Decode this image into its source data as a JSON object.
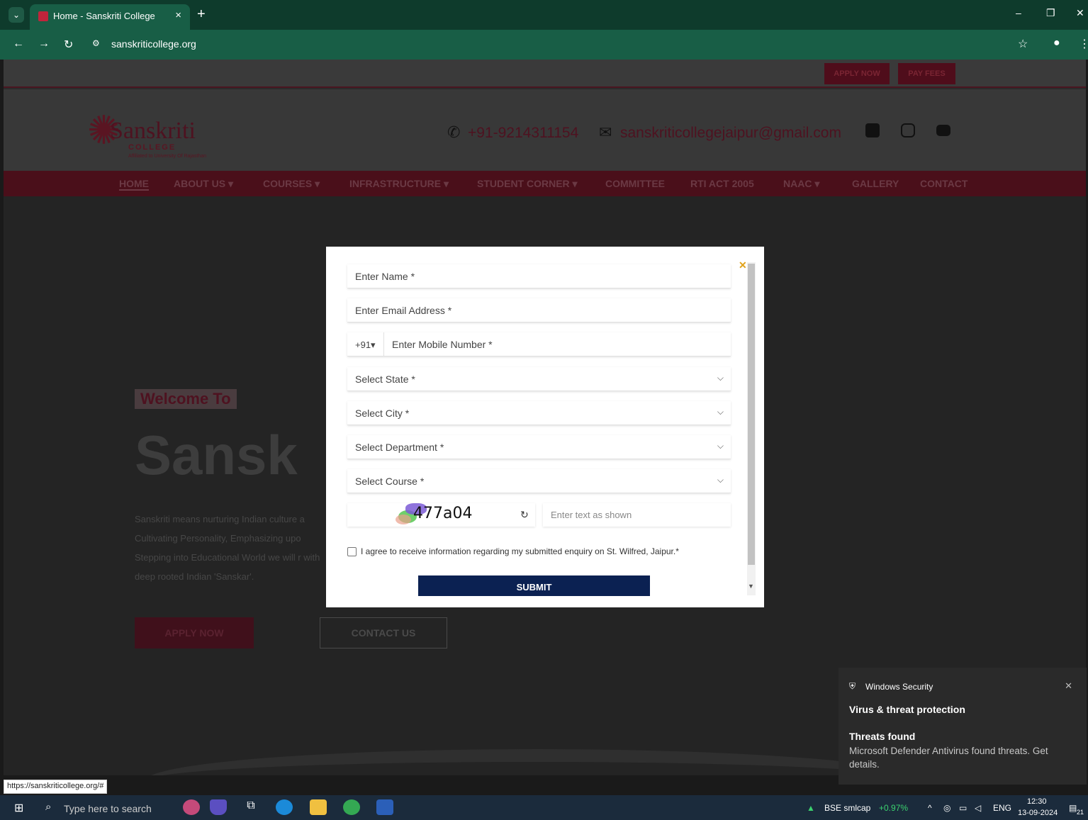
{
  "browser": {
    "tab_title": "Home - Sanskriti College",
    "url": "sanskriticollege.org",
    "status_url": "https://sanskriticollege.org/#"
  },
  "page": {
    "top_buttons": [
      "APPLY NOW",
      "PAY FEES"
    ],
    "logo_name": "Sanskriti",
    "logo_sub": "COLLEGE",
    "logo_tag": "Affiliated to University Of Rajasthan",
    "phone": "+91-9214311154",
    "email": "sanskriticollegejaipur@gmail.com",
    "nav": [
      "HOME",
      "ABOUT US ▾",
      "COURSES ▾",
      "INFRASTRUCTURE ▾",
      "STUDENT CORNER ▾",
      "COMMITTEE",
      "RTI ACT 2005",
      "NAAC ▾",
      "GALLERY",
      "CONTACT"
    ],
    "hero_welcome": "Welcome To",
    "hero_title": "Sansk",
    "hero_text": "Sanskriti means nurturing Indian culture a Cultivating Personality, Emphasizing upo Stepping into Educational World we will r with deep rooted Indian 'Sanskar'.",
    "hero_apply": "APPLY NOW",
    "hero_contact": "CONTACT US"
  },
  "modal": {
    "name_placeholder": "Enter Name *",
    "email_placeholder": "Enter Email Address *",
    "country_code": "+91▾",
    "mobile_placeholder": "Enter Mobile Number *",
    "state_select": "Select State *",
    "city_select": "Select City *",
    "department_select": "Select Department *",
    "course_select": "Select Course *",
    "captcha_code": "477a04",
    "captcha_placeholder": "Enter text as shown",
    "agree_text": "I agree to receive information regarding my submitted enquiry on St. Wilfred, Jaipur.*",
    "submit_label": "SUBMIT",
    "agree_checked": false
  },
  "toast": {
    "app": "Windows Security",
    "heading": "Virus & threat protection",
    "subheading": "Threats found",
    "body": "Microsoft Defender Antivirus found threats. Get details."
  },
  "taskbar": {
    "search_placeholder": "Type here to search",
    "stock_name": "BSE smlcap",
    "stock_change": "+0.97%",
    "language": "ENG",
    "time": "12:30",
    "date": "13-09-2024",
    "notification_count": "21"
  },
  "colors": {
    "chrome_green": "#185e46",
    "submit_navy": "#0b2152",
    "stock_green": "#3bd16f"
  }
}
